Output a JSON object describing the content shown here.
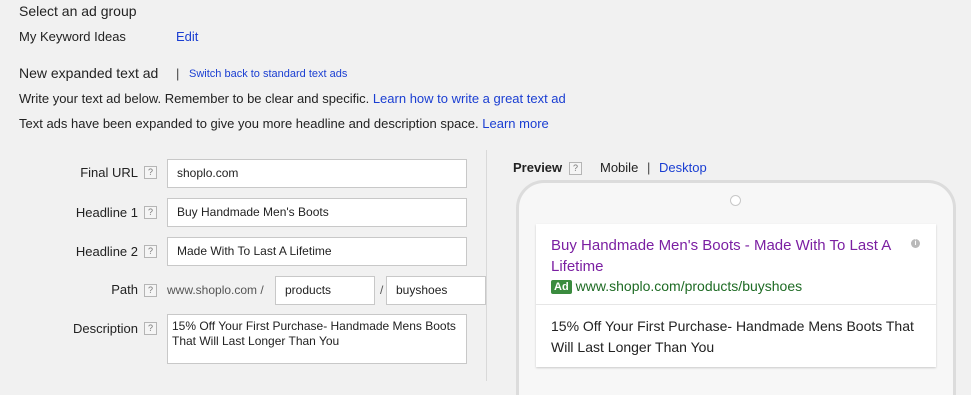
{
  "ad_group": {
    "heading": "Select an ad group",
    "name": "My Keyword Ideas",
    "edit_link": "Edit"
  },
  "intro": {
    "title": "New expanded text ad",
    "separator": "|",
    "switch_link": "Switch back to standard text ads",
    "line1_text": "Write your text ad below. Remember to be clear and specific.",
    "line1_link": "Learn how to write a great text ad",
    "line2_text": "Text ads have been expanded to give you more headline and description space.",
    "line2_link": "Learn more"
  },
  "form": {
    "help_icon": "?",
    "final_url": {
      "label": "Final URL",
      "value": "shoplo.com"
    },
    "headline1": {
      "label": "Headline 1",
      "value": "Buy Handmade Men's Boots"
    },
    "headline2": {
      "label": "Headline 2",
      "value": "Made With To Last A Lifetime"
    },
    "path": {
      "label": "Path",
      "prefix": "www.shoplo.com /",
      "slash": "/",
      "path1": "products",
      "path2": "buyshoes"
    },
    "description": {
      "label": "Description",
      "value": "15% Off Your First Purchase- Handmade Mens Boots That Will Last Longer Than You"
    }
  },
  "preview": {
    "label": "Preview",
    "mobile": "Mobile",
    "separator": "|",
    "desktop": "Desktop",
    "ad": {
      "headline": "Buy Handmade Men's Boots - Made With To Last A Lifetime",
      "badge": "Ad",
      "display_url": "www.shoplo.com/products/buyshoes",
      "description": "15% Off Your First Purchase- Handmade Mens Boots That Will Last Longer Than You"
    }
  },
  "colors": {
    "link": "#1a3ed2",
    "ad_headline": "#7b1fa2",
    "ad_url": "#1e6b24",
    "ad_badge": "#3a8b3e",
    "background": "#f1f1f1"
  }
}
